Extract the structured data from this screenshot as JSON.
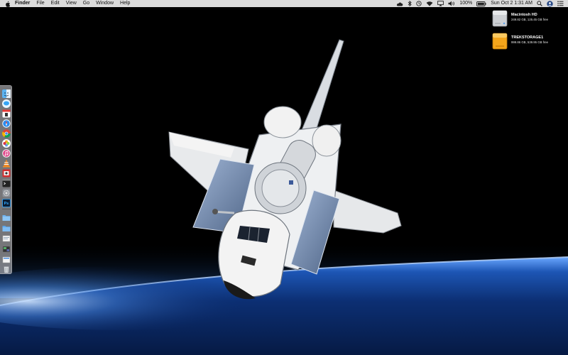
{
  "menubar": {
    "apple_icon": "apple-icon",
    "app_name": "Finder",
    "menus": [
      "File",
      "Edit",
      "View",
      "Go",
      "Window",
      "Help"
    ],
    "status_icons": [
      "cloud-icon",
      "bluetooth-icon",
      "time-machine-icon",
      "wifi-icon",
      "airplay-icon",
      "volume-icon"
    ],
    "battery_percent": "100%",
    "datetime": "Sun Oct 2  1:31 AM",
    "extra_icons": [
      "search-icon",
      "user-avatar-icon",
      "notification-center-icon"
    ]
  },
  "desktop_items": [
    {
      "name": "Macintosh HD",
      "info": "249.82 GB, 125.45 GB free",
      "icon": "hard-drive-icon"
    },
    {
      "name": "TREKSTORAGE1",
      "info": "999.86 GB, 539.95 GB free",
      "icon": "external-drive-icon"
    }
  ],
  "dock": {
    "position": "left",
    "apps": [
      "finder-icon",
      "messages-icon",
      "calendar-icon",
      "safari-icon",
      "chrome-icon",
      "photos-icon",
      "itunes-icon",
      "vlc-icon",
      "photo-booth-icon",
      "terminal-icon",
      "system-preferences-icon",
      "photoshop-icon"
    ],
    "folders": [
      "applications-folder-icon",
      "documents-folder-icon",
      "downloads-stack-icon",
      "screenshots-stack-icon",
      "recent-stack-icon",
      "trash-icon"
    ],
    "photoshop_label": "Ps"
  },
  "colors": {
    "menubar_bg": "#ececec",
    "space": "#000000",
    "atmosphere": "#3a7bd5"
  }
}
